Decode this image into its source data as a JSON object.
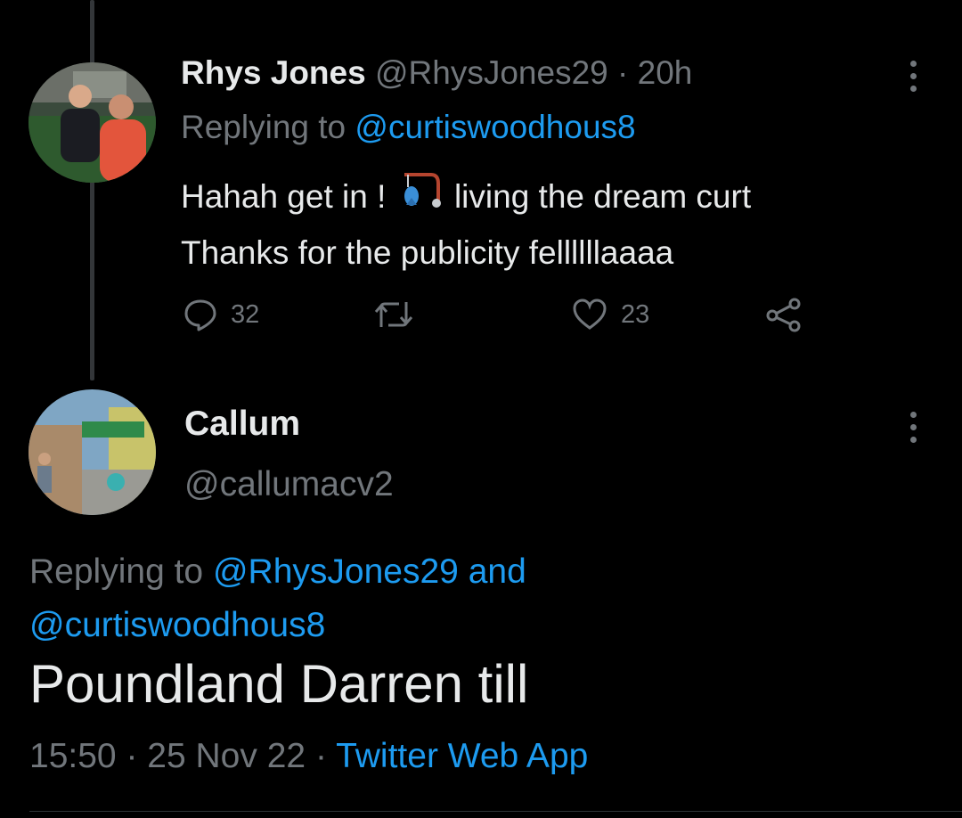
{
  "tweet1": {
    "name": "Rhys Jones",
    "handle": "@RhysJones29",
    "separator": "·",
    "time": "20h",
    "replying_prefix": "Replying to",
    "replying_to": "@curtiswoodhous8",
    "text_line1_a": "Hahah get in !",
    "emoji": "fishing-pole-emoji",
    "text_line1_b": "living the dream curt",
    "text_line2": "Thanks for the publicity fellllllaaaa",
    "replies": "32",
    "retweets": "",
    "likes": "23"
  },
  "tweet2": {
    "name": "Callum",
    "handle": "@callumacv2",
    "replying_prefix": "Replying to",
    "replying_to_1": "@RhysJones29",
    "replying_and": "and",
    "replying_to_2": "@curtiswoodhous8",
    "text": "Poundland Darren till",
    "time": "15:50",
    "sep1": "·",
    "date": "25 Nov 22",
    "sep2": "·",
    "source": "Twitter Web App"
  },
  "colors": {
    "background": "#000000",
    "text": "#e7e9ea",
    "muted": "#71767b",
    "accent": "#1d9bf0"
  }
}
